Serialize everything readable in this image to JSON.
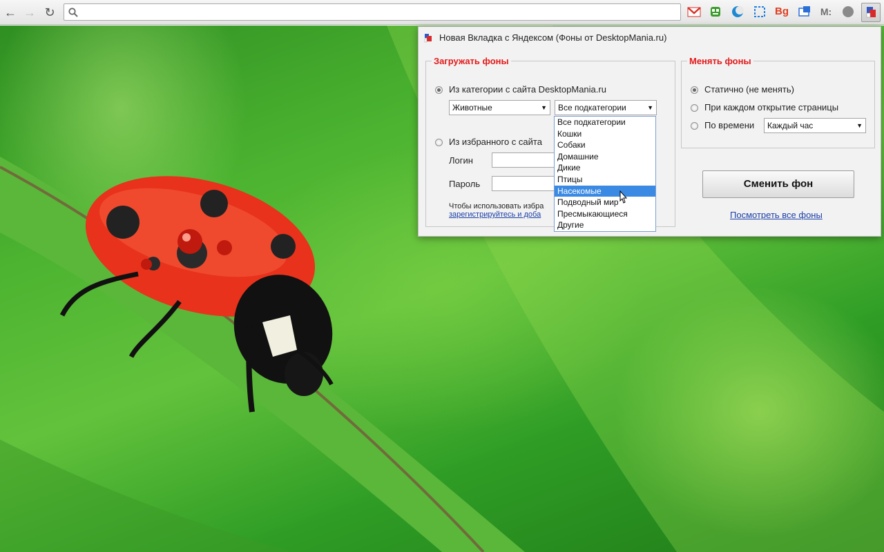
{
  "browser": {
    "omnibox_value": "",
    "extensions": [
      {
        "name": "gmail",
        "label": "M",
        "color": "#d93025"
      },
      {
        "name": "green-robot",
        "label": "",
        "color": "#3a9a2c"
      },
      {
        "name": "moon",
        "label": "",
        "color": "#1e88d2"
      },
      {
        "name": "screenshot",
        "label": "",
        "color": "#1e7fe0"
      },
      {
        "name": "bg",
        "label": "Bg",
        "color": "#e03c1f"
      },
      {
        "name": "translate",
        "label": "",
        "color": "#2a6fd6"
      },
      {
        "name": "mi",
        "label": "M:",
        "color": "#6d6d6d"
      },
      {
        "name": "speech",
        "label": "",
        "color": "#8a8a8a"
      },
      {
        "name": "yandex-tab",
        "label": "",
        "color": "#d82a2a"
      }
    ]
  },
  "popup": {
    "title": "Новая Вкладка с Яндексом (Фоны от DesktopMania.ru)",
    "load": {
      "legend": "Загружать фоны",
      "option_category": "Из категории с сайта DesktopMania.ru",
      "category_value": "Животные",
      "subcategory_value": "Все подкатегории",
      "option_favorites": "Из избранного с сайта",
      "login_label": "Логин",
      "password_label": "Пароль",
      "note_line1": "Чтобы использовать избра",
      "note_link": "зарегистрируйтесь и доба"
    },
    "change": {
      "legend": "Менять фоны",
      "option_static": "Статично (не менять)",
      "option_each_open": "При каждом открытие страницы",
      "option_by_time": "По времени",
      "time_value": "Каждый час"
    },
    "change_button": "Сменить фон",
    "view_all_link": "Посмотреть все фоны"
  },
  "dropdown": {
    "options": [
      "Все подкатегории",
      "Кошки",
      "Собаки",
      "Домашние",
      "Дикие",
      "Птицы",
      "Насекомые",
      "Подводный мир",
      "Пресмыкающиеся",
      "Другие"
    ],
    "highlighted": "Насекомые"
  }
}
